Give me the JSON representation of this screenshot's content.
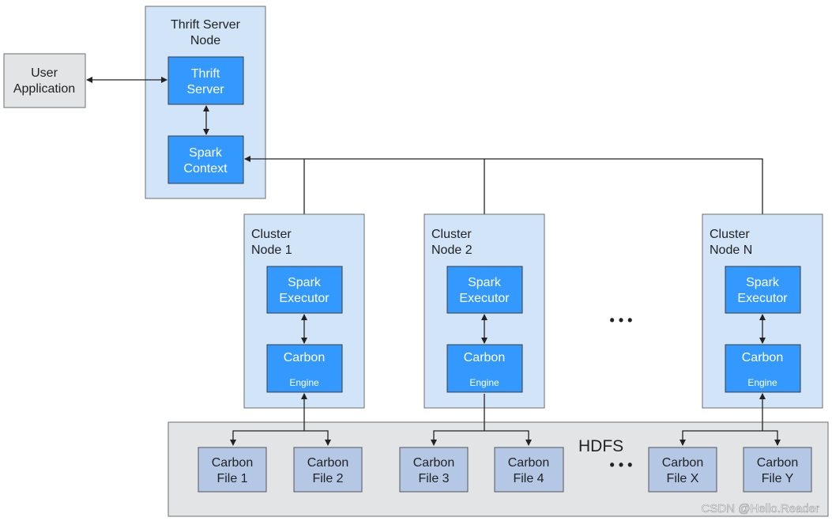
{
  "user_app": {
    "line1": "User",
    "line2": "Application"
  },
  "thrift_node": {
    "line1": "Thrift Server",
    "line2": "Node",
    "thrift_server": {
      "line1": "Thrift",
      "line2": "Server"
    },
    "spark_context": {
      "line1": "Spark",
      "line2": "Context"
    }
  },
  "clusters": [
    {
      "line1": "Cluster",
      "line2": "Node 1",
      "exec1": "Spark",
      "exec2": "Executor",
      "eng1": "Carbon",
      "eng2": "Engine"
    },
    {
      "line1": "Cluster",
      "line2": "Node 2",
      "exec1": "Spark",
      "exec2": "Executor",
      "eng1": "Carbon",
      "eng2": "Engine"
    },
    {
      "line1": "Cluster",
      "line2": "Node N",
      "exec1": "Spark",
      "exec2": "Executor",
      "eng1": "Carbon",
      "eng2": "Engine"
    }
  ],
  "ellipsis": "• • •",
  "hdfs": {
    "label": "HDFS",
    "files": [
      {
        "line1": "Carbon",
        "line2": "File 1"
      },
      {
        "line1": "Carbon",
        "line2": "File 2"
      },
      {
        "line1": "Carbon",
        "line2": "File 3"
      },
      {
        "line1": "Carbon",
        "line2": "File 4"
      },
      {
        "line1": "Carbon",
        "line2": "File X"
      },
      {
        "line1": "Carbon",
        "line2": "File Y"
      }
    ]
  },
  "watermark": "CSDN @Hello.Reader",
  "colors": {
    "node_fill": "#d2e5f8",
    "component_fill": "#3399ff",
    "file_fill": "#b4c8e6",
    "hdfs_fill": "#e2e4e6"
  }
}
